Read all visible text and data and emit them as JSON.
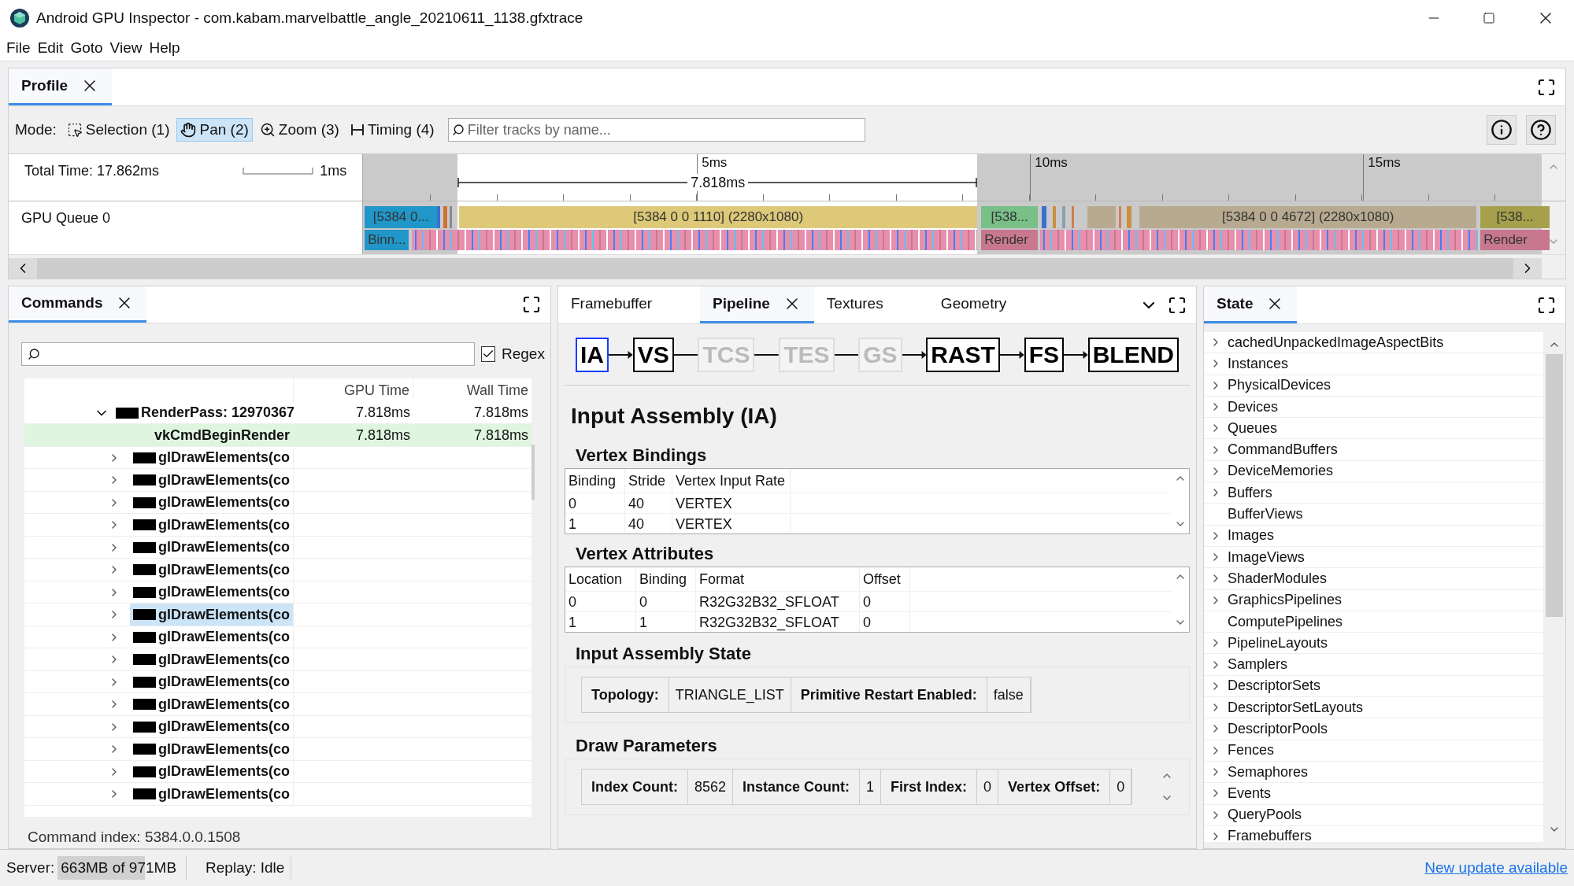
{
  "window": {
    "title": "Android GPU Inspector - com.kabam.marvelbattle_angle_20210611_1138.gfxtrace"
  },
  "menu": [
    "File",
    "Edit",
    "Goto",
    "View",
    "Help"
  ],
  "profile": {
    "tab": {
      "label": "Profile",
      "selected": true
    },
    "mode_label": "Mode:",
    "modes": [
      {
        "label": "Selection (1)",
        "selected": false,
        "kind": "selection"
      },
      {
        "label": "Pan (2)",
        "selected": true,
        "kind": "pan"
      },
      {
        "label": "Zoom (3)",
        "selected": false,
        "kind": "zoom"
      },
      {
        "label": "Timing (4)",
        "selected": false,
        "kind": "timing"
      }
    ],
    "filter": {
      "placeholder": "Filter tracks by name..."
    },
    "total_time": "Total Time: 17.862ms",
    "scale_label": "1ms",
    "ticks": [
      "5ms",
      "10ms",
      "15ms"
    ],
    "span": "7.818ms",
    "track": {
      "name": "GPU Queue 0",
      "slices": [
        {
          "label": "[5384 0...",
          "color": "#2196c8"
        },
        {
          "label": "[5384 0 0 1110] (2280x1080)",
          "color": "#ddc978"
        },
        {
          "label": "[538...",
          "color": "#78bf88"
        },
        {
          "label": "[5384 0 0 4672] (2280x1080)",
          "color": "#b8aa90"
        },
        {
          "label": "[538...",
          "color": "#a6a04c"
        }
      ],
      "sub_slices": [
        {
          "label": "Binn...",
          "color": "#2196c8"
        },
        {
          "label": "Render",
          "color": "#c7788f"
        },
        {
          "label": "Render",
          "color": "#c7788f"
        }
      ]
    }
  },
  "commands": {
    "tab": {
      "label": "Commands",
      "selected": true
    },
    "regex": {
      "label": "Regex",
      "checked": true
    },
    "columns": [
      "GPU Time",
      "Wall Time"
    ],
    "tree": [
      {
        "label": "RenderPass: 12970367",
        "expanded": true,
        "selected": false,
        "gpu_time": "7.818ms",
        "wall_time": "7.818ms",
        "children": [
          {
            "label": "vkCmdBeginRender",
            "kind": "current",
            "selected": false,
            "gpu_time": "7.818ms",
            "wall_time": "7.818ms"
          },
          {
            "label": "glDrawElements(co",
            "kind": "draw",
            "expanded": false,
            "selected": false
          },
          {
            "label": "glDrawElements(co",
            "kind": "draw",
            "expanded": false,
            "selected": false
          },
          {
            "label": "glDrawElements(co",
            "kind": "draw",
            "expanded": false,
            "selected": false
          },
          {
            "label": "glDrawElements(co",
            "kind": "draw",
            "expanded": false,
            "selected": false
          },
          {
            "label": "glDrawElements(co",
            "kind": "draw",
            "expanded": false,
            "selected": false
          },
          {
            "label": "glDrawElements(co",
            "kind": "draw",
            "expanded": false,
            "selected": false
          },
          {
            "label": "glDrawElements(co",
            "kind": "draw",
            "expanded": false,
            "selected": false
          },
          {
            "label": "glDrawElements(co",
            "kind": "draw",
            "expanded": false,
            "selected": true
          },
          {
            "label": "glDrawElements(co",
            "kind": "draw",
            "expanded": false,
            "selected": false
          },
          {
            "label": "glDrawElements(co",
            "kind": "draw",
            "expanded": false,
            "selected": false
          },
          {
            "label": "glDrawElements(co",
            "kind": "draw",
            "expanded": false,
            "selected": false
          },
          {
            "label": "glDrawElements(co",
            "kind": "draw",
            "expanded": false,
            "selected": false
          },
          {
            "label": "glDrawElements(co",
            "kind": "draw",
            "expanded": false,
            "selected": false
          },
          {
            "label": "glDrawElements(co",
            "kind": "draw",
            "expanded": false,
            "selected": false
          },
          {
            "label": "glDrawElements(co",
            "kind": "draw",
            "expanded": false,
            "selected": false
          },
          {
            "label": "glDrawElements(co",
            "kind": "draw",
            "expanded": false,
            "selected": false
          }
        ]
      }
    ],
    "command_index": "Command index: 5384.0.0.1508"
  },
  "pipeline": {
    "tabs": [
      {
        "label": "Framebuffer",
        "selected": false
      },
      {
        "label": "Pipeline",
        "selected": true
      },
      {
        "label": "Textures",
        "selected": false
      },
      {
        "label": "Geometry",
        "selected": false
      }
    ],
    "stages": [
      {
        "label": "IA",
        "selected": true,
        "disabled": false
      },
      {
        "label": "VS",
        "selected": false,
        "disabled": false
      },
      {
        "label": "TCS",
        "selected": false,
        "disabled": true
      },
      {
        "label": "TES",
        "selected": false,
        "disabled": true
      },
      {
        "label": "GS",
        "selected": false,
        "disabled": true
      },
      {
        "label": "RAST",
        "selected": false,
        "disabled": false
      },
      {
        "label": "FS",
        "selected": false,
        "disabled": false
      },
      {
        "label": "BLEND",
        "selected": false,
        "disabled": false
      }
    ],
    "heading": "Input Assembly (IA)",
    "vertex_bindings": {
      "title": "Vertex Bindings",
      "columns": [
        "Binding",
        "Stride",
        "Vertex Input Rate"
      ],
      "rows": [
        [
          "0",
          "40",
          "VERTEX"
        ],
        [
          "1",
          "40",
          "VERTEX"
        ]
      ]
    },
    "vertex_attributes": {
      "title": "Vertex Attributes",
      "columns": [
        "Location",
        "Binding",
        "Format",
        "Offset"
      ],
      "rows": [
        [
          "0",
          "0",
          "R32G32B32_SFLOAT",
          "0"
        ],
        [
          "1",
          "1",
          "R32G32B32_SFLOAT",
          "0"
        ]
      ]
    },
    "input_assembly_state": {
      "title": "Input Assembly State",
      "fields": [
        {
          "label": "Topology:",
          "value": "TRIANGLE_LIST"
        },
        {
          "label": "Primitive Restart Enabled:",
          "value": "false"
        }
      ]
    },
    "draw_parameters": {
      "title": "Draw Parameters",
      "fields": [
        {
          "label": "Index Count:",
          "value": "8562"
        },
        {
          "label": "Instance Count:",
          "value": "1"
        },
        {
          "label": "First Index:",
          "value": "0"
        },
        {
          "label": "Vertex Offset:",
          "value": "0"
        }
      ]
    }
  },
  "state": {
    "tab": {
      "label": "State",
      "selected": true
    },
    "items": [
      {
        "label": "cachedUnpackedImageAspectBits",
        "expandable": true
      },
      {
        "label": "Instances",
        "expandable": true
      },
      {
        "label": "PhysicalDevices",
        "expandable": true
      },
      {
        "label": "Devices",
        "expandable": true
      },
      {
        "label": "Queues",
        "expandable": true
      },
      {
        "label": "CommandBuffers",
        "expandable": true
      },
      {
        "label": "DeviceMemories",
        "expandable": true
      },
      {
        "label": "Buffers",
        "expandable": true
      },
      {
        "label": "BufferViews",
        "expandable": false
      },
      {
        "label": "Images",
        "expandable": true
      },
      {
        "label": "ImageViews",
        "expandable": true
      },
      {
        "label": "ShaderModules",
        "expandable": true
      },
      {
        "label": "GraphicsPipelines",
        "expandable": true
      },
      {
        "label": "ComputePipelines",
        "expandable": false
      },
      {
        "label": "PipelineLayouts",
        "expandable": true
      },
      {
        "label": "Samplers",
        "expandable": true
      },
      {
        "label": "DescriptorSets",
        "expandable": true
      },
      {
        "label": "DescriptorSetLayouts",
        "expandable": true
      },
      {
        "label": "DescriptorPools",
        "expandable": true
      },
      {
        "label": "Fences",
        "expandable": true
      },
      {
        "label": "Semaphores",
        "expandable": true
      },
      {
        "label": "Events",
        "expandable": true
      },
      {
        "label": "QueryPools",
        "expandable": true
      },
      {
        "label": "Framebuffers",
        "expandable": true
      }
    ]
  },
  "status_bar": {
    "server_label": "Server:",
    "memory": {
      "text": "663MB of 971MB",
      "level": 0.68
    },
    "replay": "Replay: Idle",
    "update_link": "New update available"
  }
}
